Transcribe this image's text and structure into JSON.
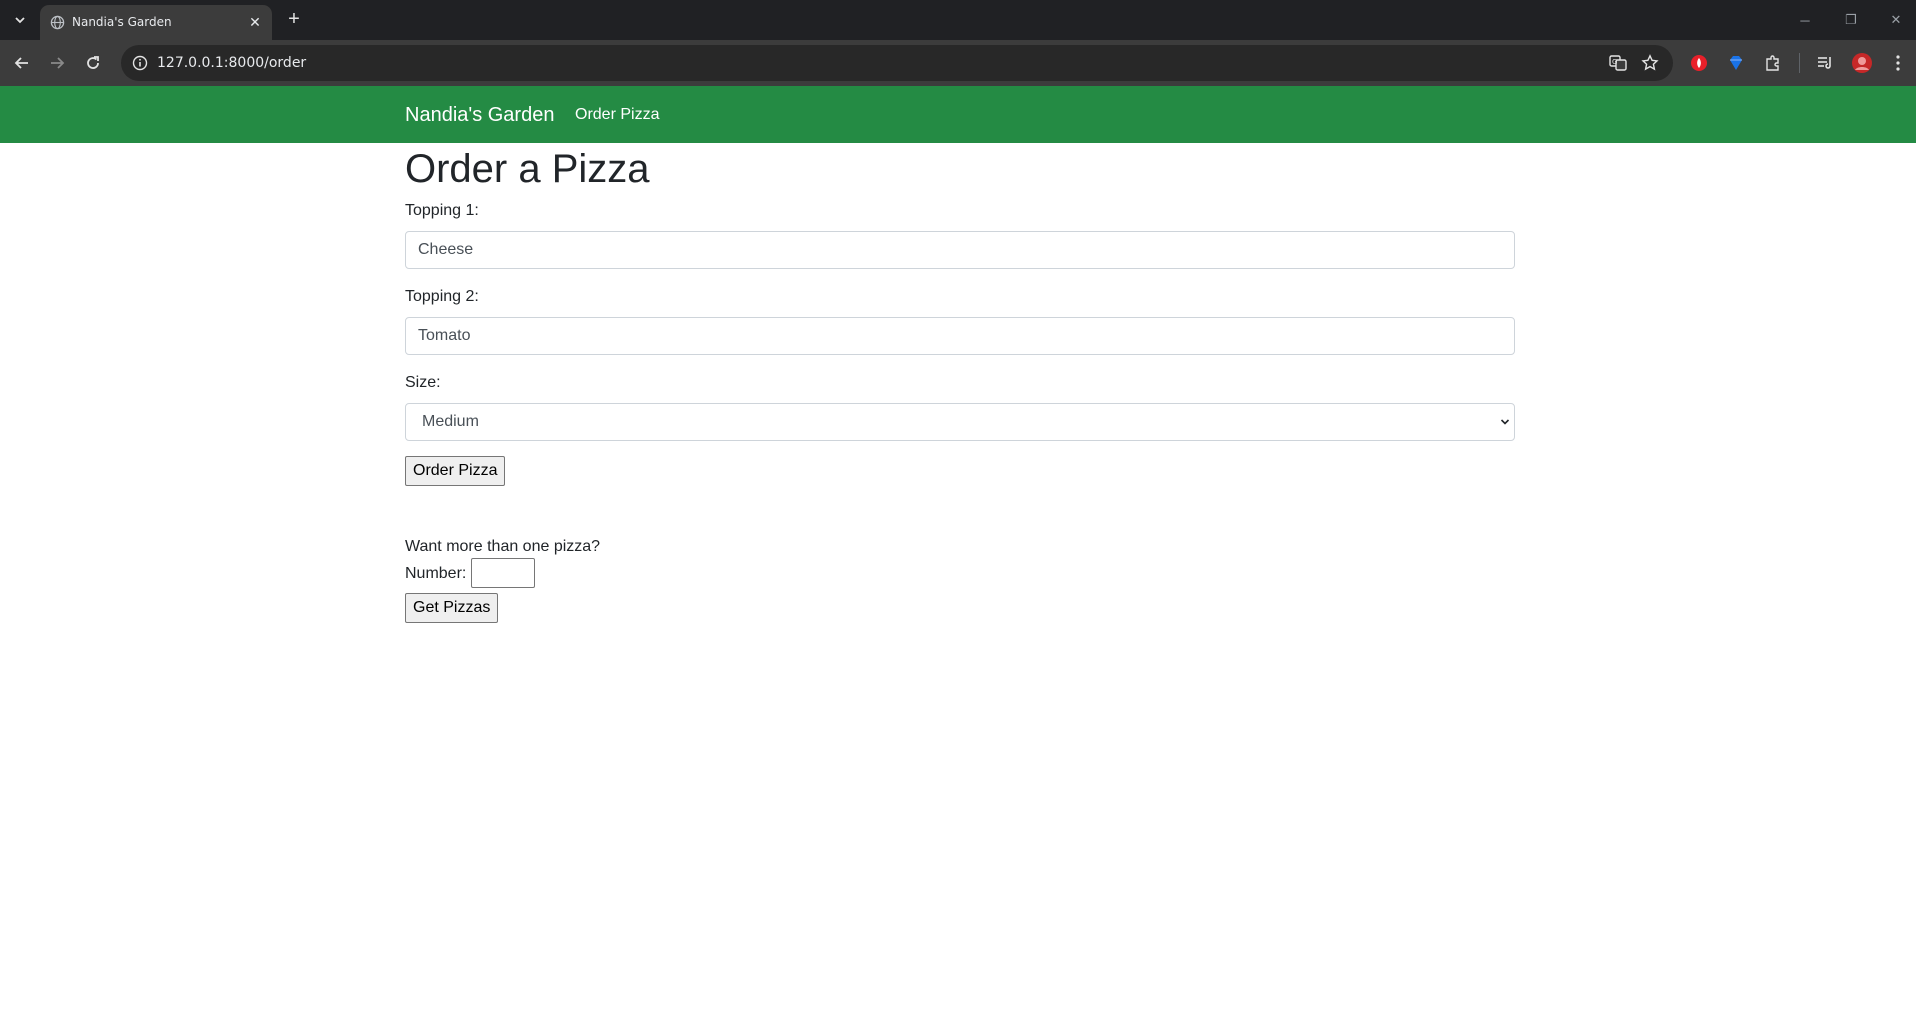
{
  "browser": {
    "tab_title": "Nandia's Garden",
    "url": "127.0.0.1:8000/order"
  },
  "navbar": {
    "brand": "Nandia's Garden",
    "link": "Order Pizza",
    "color": "#248b44"
  },
  "page": {
    "title": "Order a Pizza",
    "topping1": {
      "label": "Topping 1:",
      "value": "Cheese"
    },
    "topping2": {
      "label": "Topping 2:",
      "value": "Tomato"
    },
    "size": {
      "label": "Size:",
      "selected": "Medium"
    },
    "order_button": "Order Pizza",
    "multi": {
      "prompt": "Want more than one pizza?",
      "number_label": "Number:",
      "number_value": "",
      "button": "Get Pizzas"
    }
  }
}
